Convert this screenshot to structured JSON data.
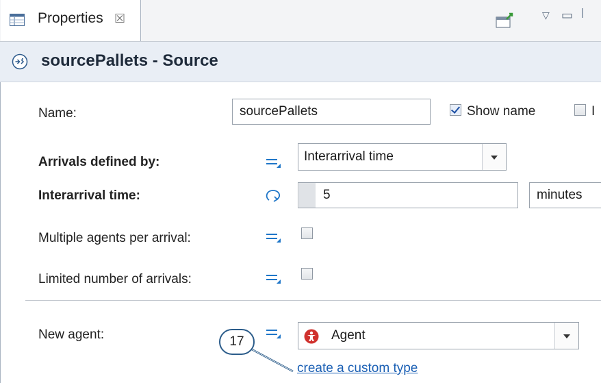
{
  "tab": {
    "label": "Properties",
    "close_symbol": "☒"
  },
  "header": {
    "title": "sourcePallets - Source",
    "icon": "source-icon"
  },
  "form": {
    "name_label": "Name:",
    "name_value": "sourcePallets",
    "show_name_label": "Show name",
    "show_name_checked": true,
    "ignore_label": "I",
    "arrivals_label": "Arrivals defined by:",
    "arrivals_value": "Interarrival time",
    "interarrival_label": "Interarrival time:",
    "interarrival_value": "5",
    "interarrival_unit": "minutes",
    "multiple_agents_label": "Multiple agents per arrival:",
    "limited_arrivals_label": "Limited number of arrivals:",
    "new_agent_label": "New agent:",
    "new_agent_value": "Agent",
    "custom_type_link": "create a custom type"
  },
  "callout": {
    "number": "17"
  },
  "colors": {
    "header_bg": "#e9eef5",
    "link": "#1a5fb4",
    "callout_border": "#2b5c8a",
    "agent_icon": "#d0312d",
    "eq_icon": "#1f76c8"
  }
}
